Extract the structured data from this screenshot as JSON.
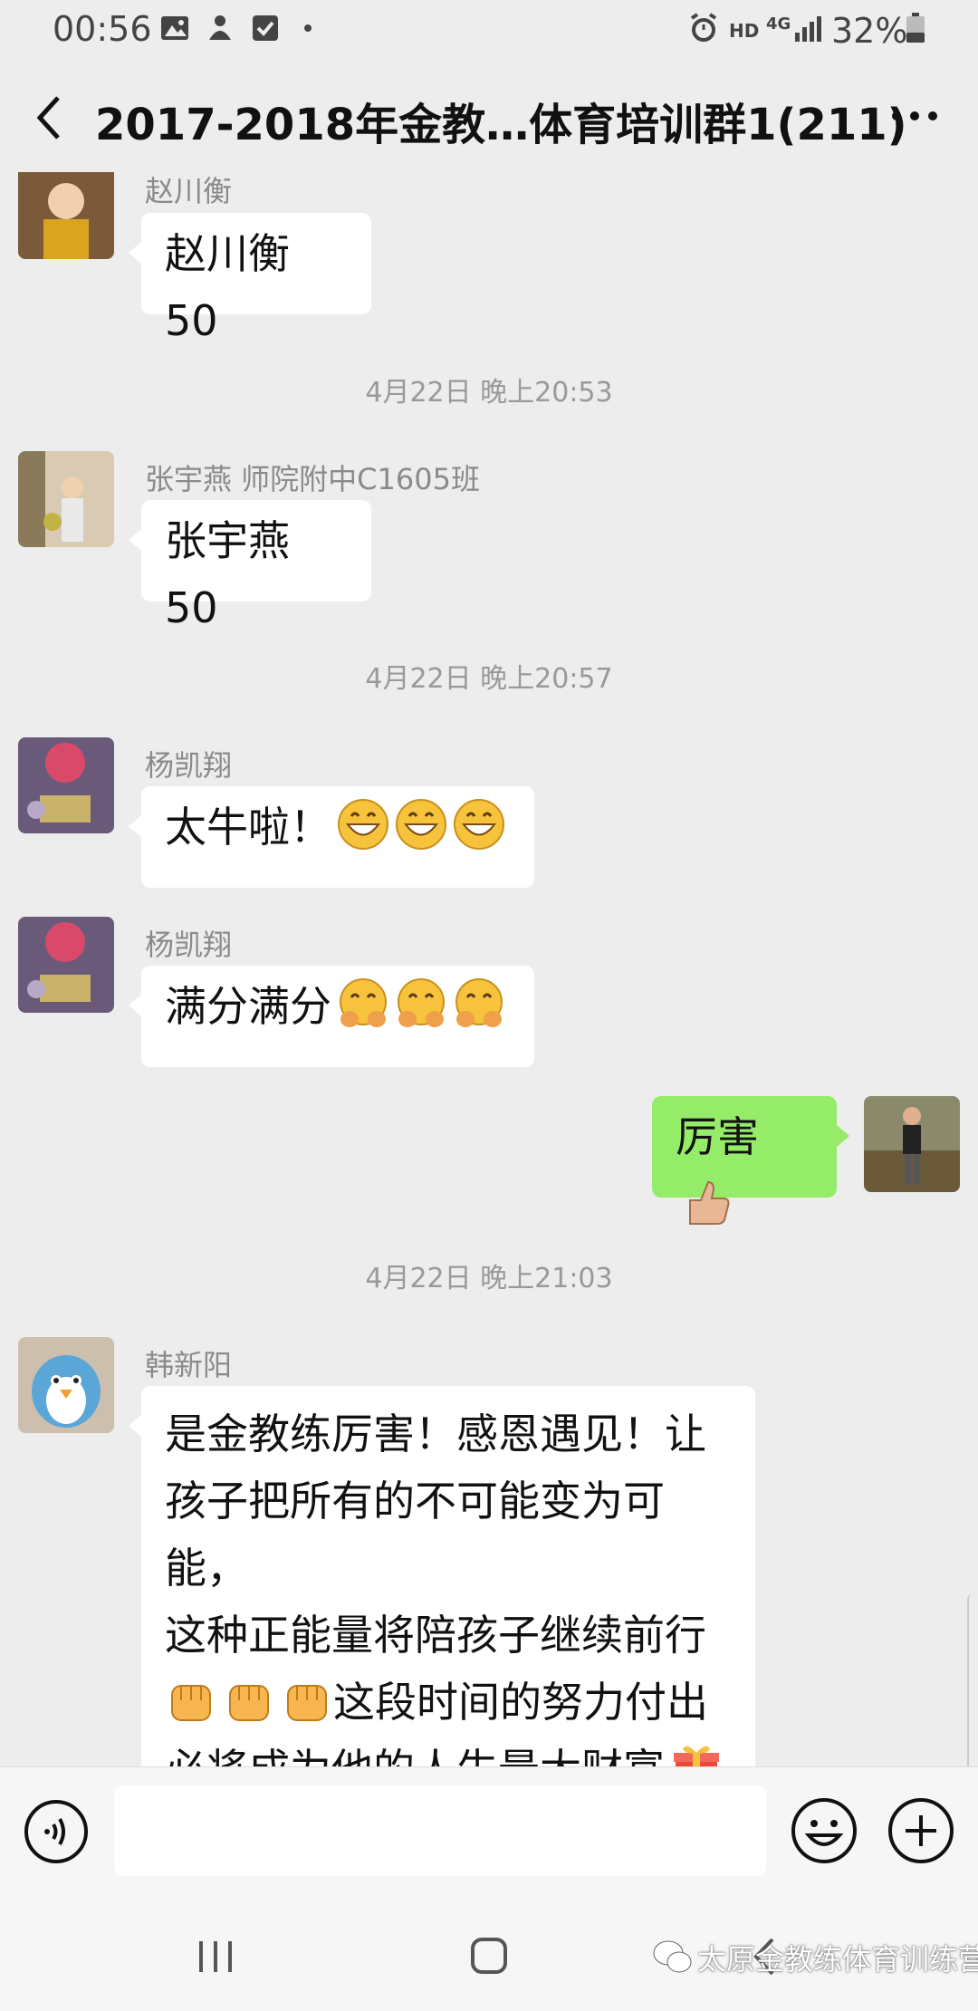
{
  "status_bar": {
    "time": "00:56",
    "battery": "32%",
    "network_hd": "HD",
    "network_4g": "4G"
  },
  "header": {
    "title": "2017-2018年金教…体育培训群1(211)"
  },
  "messages": [
    {
      "sender": "赵川衡",
      "text": "赵川衡 50"
    },
    {
      "timestamp": "4月22日 晚上20:53"
    },
    {
      "sender": "张宇燕 师院附中C1605班",
      "text": "张宇燕 50"
    },
    {
      "timestamp": "4月22日 晚上20:57"
    },
    {
      "sender": "杨凯翔",
      "text": "太牛啦！",
      "emoji": "grin-emoji x3"
    },
    {
      "sender": "杨凯翔",
      "text": "满分满分",
      "emoji": "hug-emoji x3"
    },
    {
      "text": "厉害",
      "emoji": "thumbs-up-emoji",
      "self": true
    },
    {
      "timestamp": "4月22日 晚上21:03"
    },
    {
      "sender": "韩新阳",
      "lines": [
        "是金教练厉害！感恩遇见！让",
        "孩子把所有的不可能变为可能，",
        "这种正能量将陪孩子继续前行",
        "这段时间的努力付出",
        "必将成为他的人生最大财富"
      ]
    }
  ],
  "watermark": "太原金教练体育训练营",
  "colors": {
    "background": "#ededed",
    "bubble_self": "#95ec69",
    "bubble_other": "#ffffff"
  }
}
